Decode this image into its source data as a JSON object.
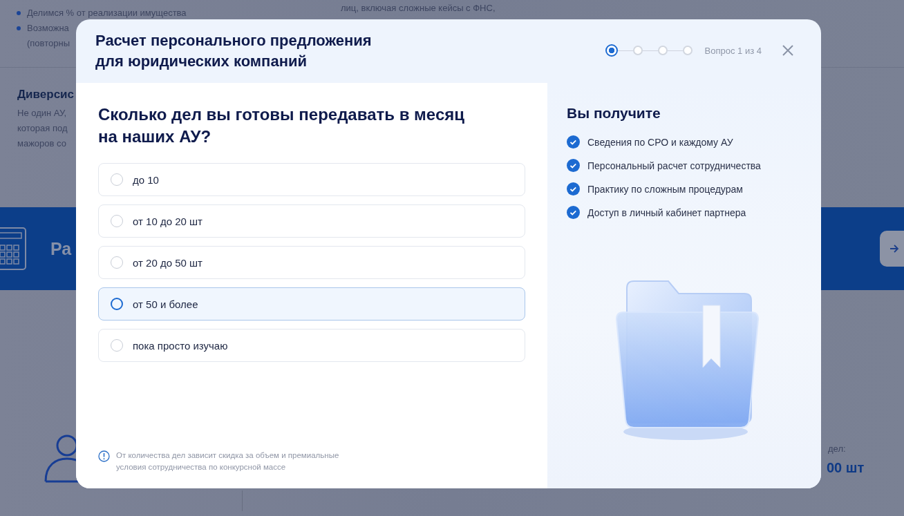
{
  "background": {
    "list_items": [
      {
        "lines": [
          "Делимся % от реализации имущества"
        ]
      },
      {
        "lines": [
          "Возможна",
          "(повторны"
        ]
      }
    ],
    "column_text": "лиц, включая сложные кейсы с ФНС,",
    "section_heading": "Диверсис",
    "section_lines": [
      "Не один АУ,",
      "которая под",
      "мажоров со"
    ],
    "banner_title": "Ра",
    "stat_label": "дел:",
    "stat_value": "00 шт"
  },
  "modal": {
    "title_lines": [
      "Расчет персонального предложения",
      "для юридических компаний"
    ],
    "steps": [
      {
        "current": true
      },
      {
        "current": false
      },
      {
        "current": false
      },
      {
        "current": false
      }
    ],
    "progress": "Вопрос 1 из 4",
    "question_lines": [
      "Сколько дел вы готовы передавать в месяц",
      "на наших АУ?"
    ],
    "options": [
      {
        "label": "до 10",
        "selected": false
      },
      {
        "label": "от 10 до 20 шт",
        "selected": false
      },
      {
        "label": "от 20 до 50 шт",
        "selected": false
      },
      {
        "label": "от 50 и более",
        "selected": true
      },
      {
        "label": "пока просто изучаю",
        "selected": false
      }
    ],
    "note_lines": [
      "От количества дел зависит скидка за объем и премиальные",
      "условия сотрудничества по конкурсной массе"
    ],
    "benefits": {
      "title": "Вы получите",
      "items": [
        "Сведения по СРО и каждому АУ",
        "Персональный расчет сотрудничества",
        "Практику по сложным процедурам",
        "Доступ в личный кабинет партнера"
      ]
    }
  }
}
